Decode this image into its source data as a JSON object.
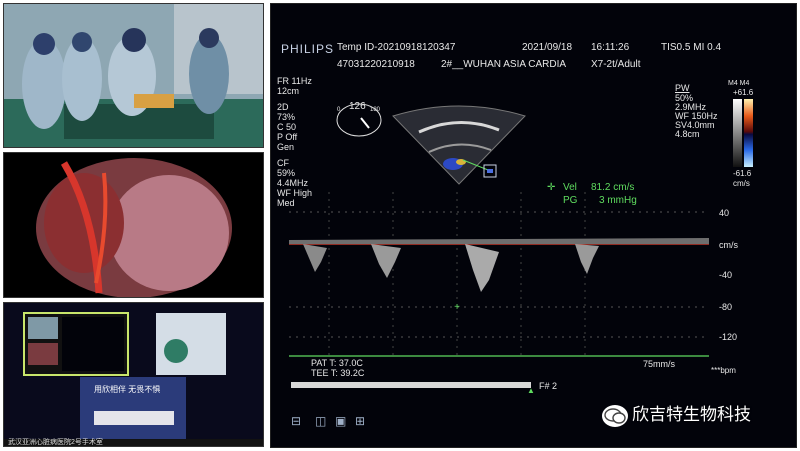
{
  "echo": {
    "brand": "PHILIPS",
    "temp_id": "Temp ID-20210918120347",
    "date": "2021/09/18",
    "time": "16:11:26",
    "tis_mi": "TIS0.5  MI 0.4",
    "patient_id": "47031220210918",
    "hospital": "2#__WUHAN ASIA CARDIA",
    "probe": "X7-2t/Adult",
    "left_params": [
      "FR 11Hz",
      "12cm",
      "2D",
      "73%",
      "C 50",
      "P Off",
      "Gen",
      "CF",
      "59%",
      "4.4MHz",
      "WF High",
      "Med"
    ],
    "angle": {
      "value": "126",
      "min": "0",
      "max": "180"
    },
    "pw": {
      "title": "PW",
      "lines": [
        "50%",
        "2.9MHz",
        "WF 150Hz",
        "SV4.0mm",
        "4.8cm"
      ]
    },
    "colorbar": {
      "top_label": "M4 M4",
      "max": "+61.6",
      "min": "-61.6",
      "unit": "cm/s"
    },
    "measurements": {
      "vel_label": "Vel",
      "vel_value": "81.2 cm/s",
      "pg_label": "PG",
      "pg_value": "3 mmHg"
    },
    "scale": [
      "40",
      "cm/s",
      "-40",
      "-80",
      "-120"
    ],
    "sweep": "75mm/s",
    "bpm": "***bpm",
    "pat_t": "PAT T: 37.0C",
    "tee_t": "TEE T: 39.2C",
    "frame": "F# 2",
    "icons": [
      "probe-icon",
      "icon2",
      "icon3",
      "icon4"
    ]
  },
  "meeting": {
    "banner": "用欣相伴 无畏不惧",
    "caption": "武汉亚洲心脏病医院2号手术室"
  },
  "watermark": "欣吉特生物科技",
  "colors": {
    "green": "#5fdc5f",
    "scan_bg": "#02030a",
    "baseline": "#c0392b"
  }
}
